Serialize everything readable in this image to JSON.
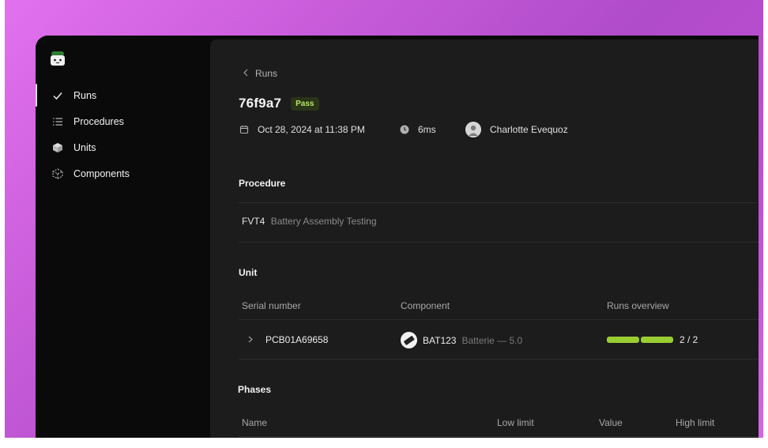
{
  "sidebar": {
    "items": [
      {
        "label": "Runs",
        "icon": "check-icon"
      },
      {
        "label": "Procedures",
        "icon": "list-icon"
      },
      {
        "label": "Units",
        "icon": "cube-icon"
      },
      {
        "label": "Components",
        "icon": "dashed-cube-icon"
      }
    ]
  },
  "header": {
    "back_label": "Runs",
    "run_id": "76f9a7",
    "status": "Pass",
    "date": "Oct 28, 2024 at 11:38 PM",
    "duration": "6ms",
    "user": "Charlotte Evequoz"
  },
  "procedure": {
    "section_title": "Procedure",
    "code": "FVT4",
    "name": "Battery Assembly Testing"
  },
  "unit": {
    "section_title": "Unit",
    "columns": [
      "Serial number",
      "Component",
      "Runs overview"
    ],
    "row": {
      "serial": "PCB01A69658",
      "component_code": "BAT123",
      "component_desc": "Batterie — 5.0",
      "runs": "2 / 2",
      "runs_passed": 2,
      "runs_total": 2
    }
  },
  "phases": {
    "section_title": "Phases",
    "columns": [
      "Name",
      "Low limit",
      "Value",
      "High limit"
    ]
  },
  "colors": {
    "accent_pass": "#9acd32",
    "background": "#1c1c1c",
    "sidebar": "#0a0a0a"
  }
}
